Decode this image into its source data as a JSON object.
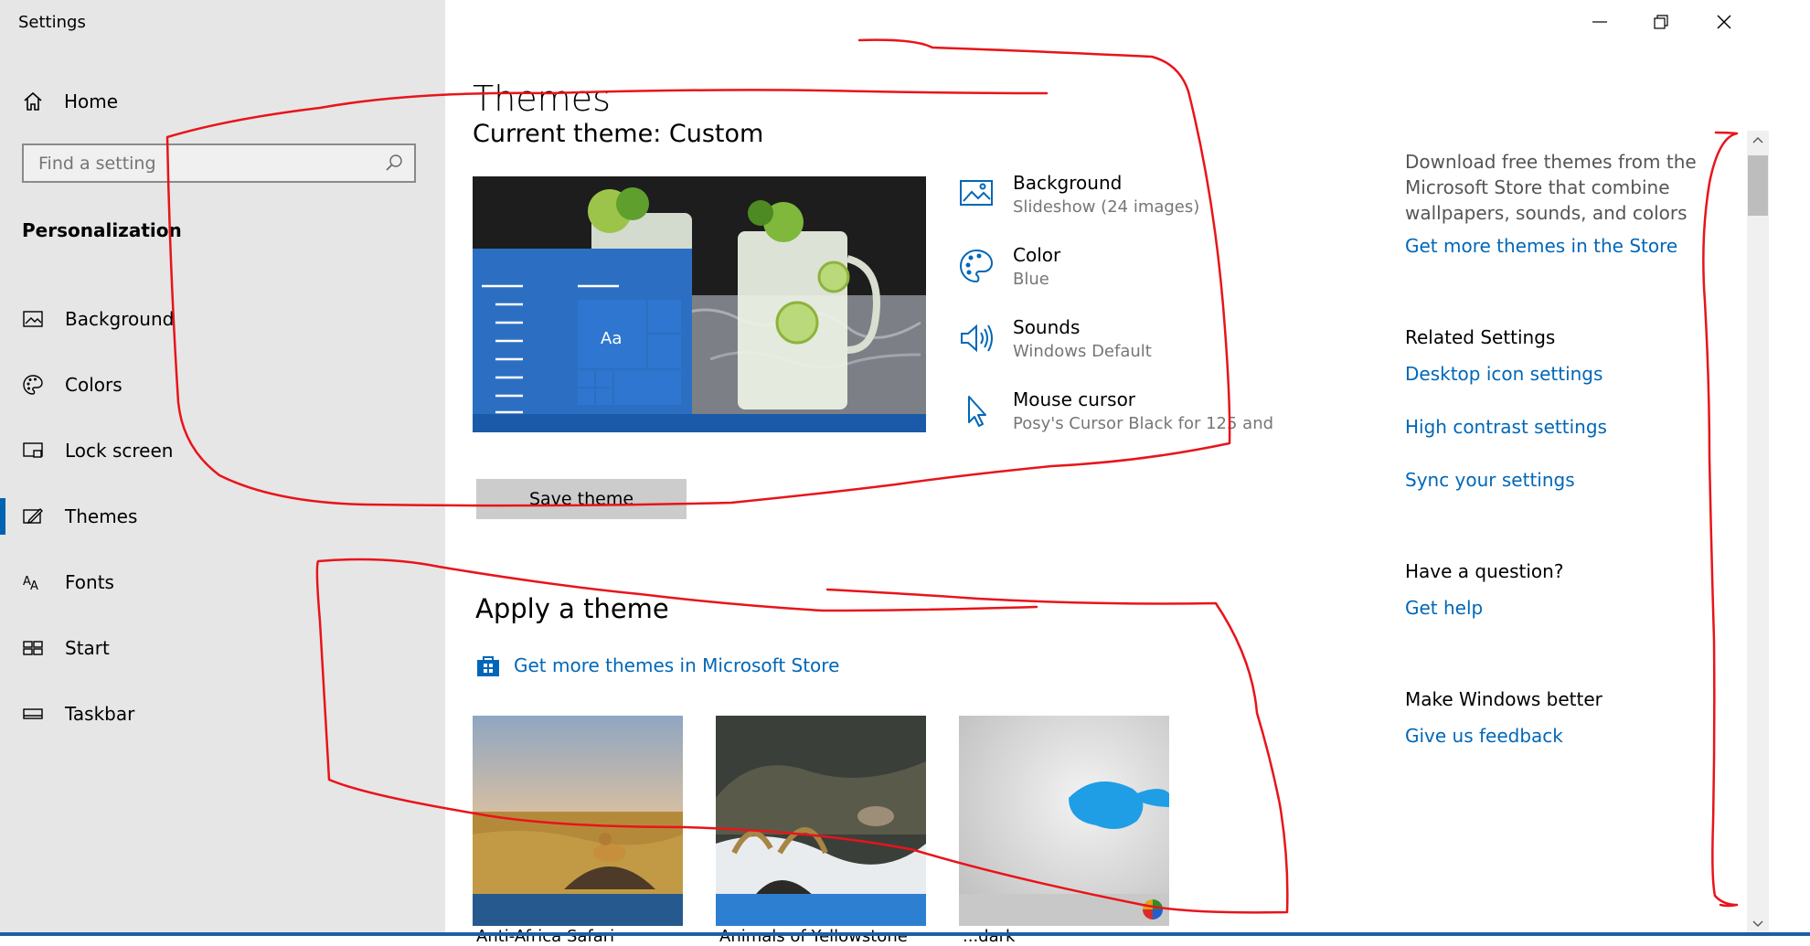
{
  "window": {
    "title": "Settings"
  },
  "sidebar": {
    "home_label": "Home",
    "search_placeholder": "Find a setting",
    "section_title": "Personalization",
    "items": [
      {
        "label": "Background",
        "icon": "picture-icon"
      },
      {
        "label": "Colors",
        "icon": "palette-icon"
      },
      {
        "label": "Lock screen",
        "icon": "lock-screen-icon"
      },
      {
        "label": "Themes",
        "icon": "themes-icon",
        "active": true
      },
      {
        "label": "Fonts",
        "icon": "fonts-icon"
      },
      {
        "label": "Start",
        "icon": "start-icon"
      },
      {
        "label": "Taskbar",
        "icon": "taskbar-icon"
      }
    ]
  },
  "main": {
    "title": "Themes",
    "current_theme": "Current theme: Custom",
    "preview_tile_label": "Aa",
    "theme_settings": [
      {
        "name": "Background",
        "value": "Slideshow (24 images)",
        "icon": "picture-icon"
      },
      {
        "name": "Color",
        "value": "Blue",
        "icon": "palette-icon"
      },
      {
        "name": "Sounds",
        "value": "Windows Default",
        "icon": "speaker-icon"
      },
      {
        "name": "Mouse cursor",
        "value": "Posy's Cursor Black for 125 and",
        "icon": "cursor-icon"
      }
    ],
    "save_button": "Save theme",
    "apply_title": "Apply a theme",
    "store_link": "Get more themes in Microsoft Store",
    "themes": [
      {
        "label": "Anti-Africa Safari"
      },
      {
        "label": "Animals of Yellowstone"
      },
      {
        "label": "...dark"
      }
    ]
  },
  "right": {
    "store_text": "Download free themes from the Microsoft Store that combine wallpapers, sounds, and colors",
    "store_link": "Get more themes in the Store",
    "related_title": "Related Settings",
    "related_links": [
      "Desktop icon settings",
      "High contrast settings",
      "Sync your settings"
    ],
    "question_title": "Have a question?",
    "help_link": "Get help",
    "better_title": "Make Windows better",
    "feedback_link": "Give us feedback"
  },
  "colors": {
    "accent": "#0067b8",
    "sidebar_bg": "#e6e6e6",
    "annotation": "#e8141a"
  }
}
